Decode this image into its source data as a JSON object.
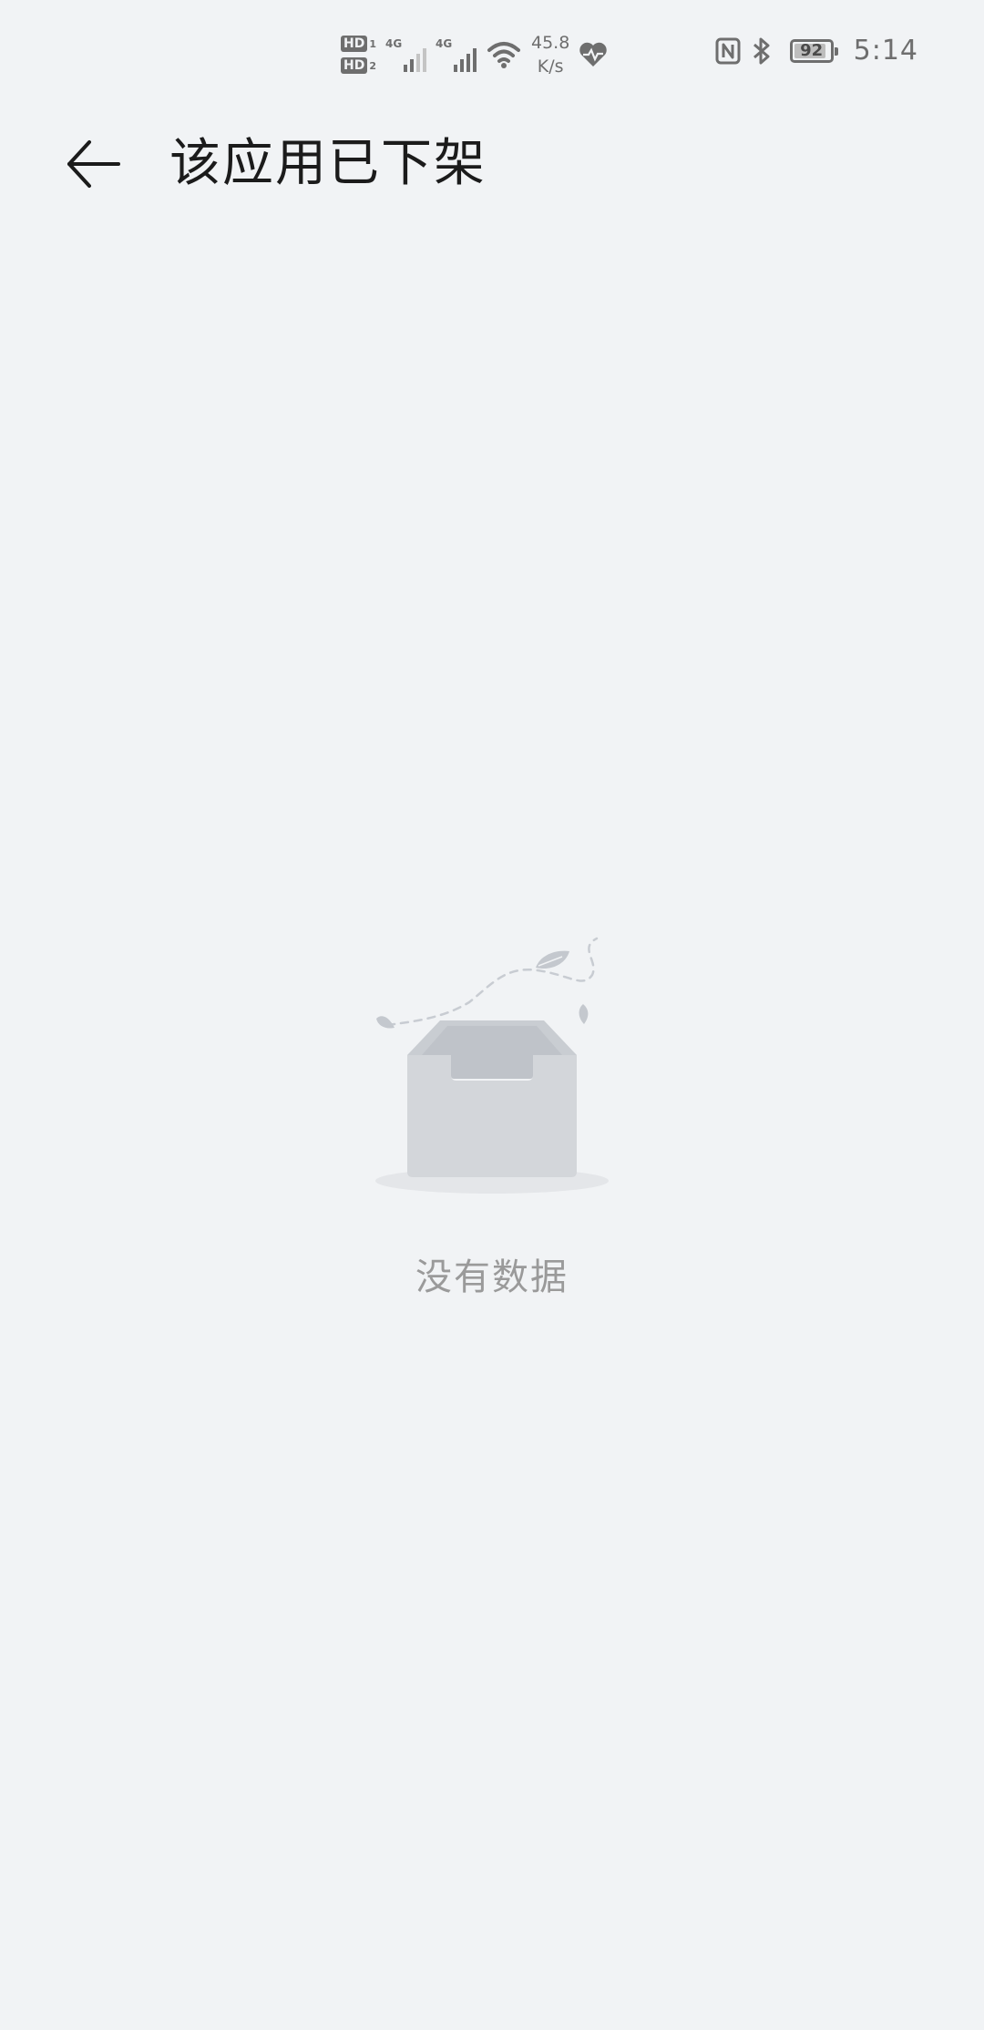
{
  "status_bar": {
    "sim1_label": "HD",
    "sim1_num": "1",
    "sim2_label": "HD",
    "sim2_num": "2",
    "signal1_tag": "4G",
    "signal2_tag": "4G",
    "speed_value": "45.8",
    "speed_unit": "K/s",
    "battery_level": "92",
    "battery_fraction": 0.92,
    "time": "5:14",
    "icons": [
      "hd-icon",
      "signal-icon",
      "wifi-icon",
      "heart-health-icon",
      "nfc-icon",
      "bluetooth-icon",
      "battery-icon"
    ]
  },
  "app_bar": {
    "title": "该应用已下架",
    "back_icon": "back-arrow-icon"
  },
  "empty_state": {
    "message": "没有数据",
    "illustration": "empty-inbox-illustration"
  },
  "colors": {
    "background": "#f1f3f5",
    "title_text": "#1b1b1b",
    "muted_text": "#9a9a9a",
    "status_icons": "#6e6e6e"
  }
}
